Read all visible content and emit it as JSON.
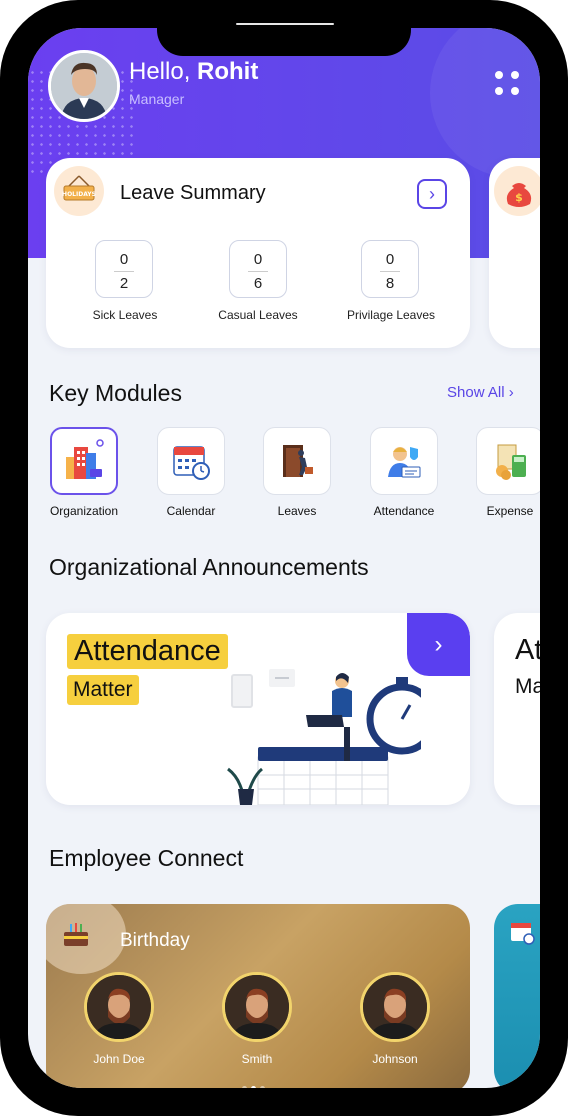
{
  "header": {
    "greeting": "Hello,",
    "user_name": "Rohit",
    "role": "Manager"
  },
  "leave_summary": {
    "title": "Leave Summary",
    "items": [
      {
        "label": "Sick Leaves",
        "top": "0",
        "bottom": "2"
      },
      {
        "label": "Casual Leaves",
        "top": "0",
        "bottom": "6"
      },
      {
        "label": "Privilage Leaves",
        "top": "0",
        "bottom": "8"
      }
    ]
  },
  "modules": {
    "title": "Key Modules",
    "show_all": "Show All",
    "items": [
      {
        "label": "Organization",
        "icon": "building-icon"
      },
      {
        "label": "Calendar",
        "icon": "calendar-icon"
      },
      {
        "label": "Leaves",
        "icon": "door-exit-icon"
      },
      {
        "label": "Attendance",
        "icon": "id-badge-icon"
      },
      {
        "label": "Expense",
        "icon": "money-calculator-icon"
      }
    ]
  },
  "announcements": {
    "title": "Organizational Announcements",
    "card": {
      "headline": "Attendance",
      "subline": "Matter"
    },
    "peek": {
      "headline": "At",
      "subline": "Ma"
    }
  },
  "employee_connect": {
    "title": "Employee Connect",
    "birthday_title": "Birthday",
    "people": [
      "John Doe",
      "Smith",
      "Johnson"
    ]
  },
  "colors": {
    "primary": "#5a45e6",
    "highlight": "#f6cf3e"
  }
}
